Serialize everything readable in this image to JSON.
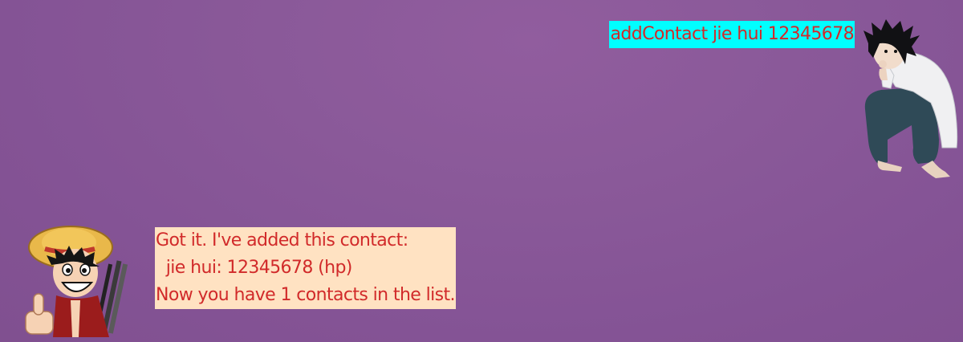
{
  "user_message": {
    "text": "addContact jie hui 12345678",
    "bubble_color": "#00ffff",
    "text_color": "#d12a2a",
    "avatar_icon": "user-avatar-icon"
  },
  "bot_message": {
    "lines": [
      "Got it. I've added this contact:",
      "  jie hui: 12345678 (hp)",
      "Now you have 1 contacts in the list."
    ],
    "bubble_color": "#ffe2c2",
    "text_color": "#d12a2a",
    "avatar_icon": "bot-avatar-icon"
  },
  "background_color": "#8a5999"
}
